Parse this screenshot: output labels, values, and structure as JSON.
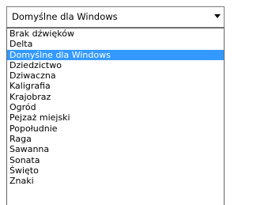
{
  "combobox": {
    "value": "Domyślne dla Windows",
    "arrow_icon": "triangle-down-icon"
  },
  "dropdown": {
    "selected_index": 2,
    "selection_color": "#3399ff",
    "items": [
      {
        "label": "Brak dźwięków"
      },
      {
        "label": "Delta"
      },
      {
        "label": "Domyślne dla Windows"
      },
      {
        "label": "Dziedzictwo"
      },
      {
        "label": "Dziwaczna"
      },
      {
        "label": "Kaligrafia"
      },
      {
        "label": "Krajobraz"
      },
      {
        "label": "Ogród"
      },
      {
        "label": "Pejzaż miejski"
      },
      {
        "label": "Popołudnie"
      },
      {
        "label": "Raga"
      },
      {
        "label": "Sawanna"
      },
      {
        "label": "Sonata"
      },
      {
        "label": "Święto"
      },
      {
        "label": "Znaki"
      }
    ]
  }
}
